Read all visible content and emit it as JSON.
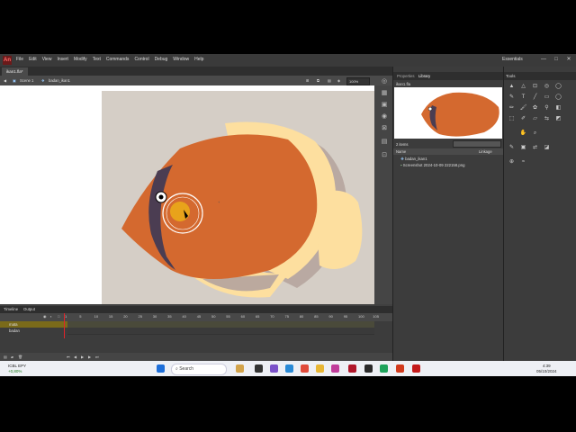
{
  "app": {
    "logo": "An",
    "workspace": "Essentials",
    "window_buttons": [
      "—",
      "□",
      "✕"
    ]
  },
  "menu": [
    "File",
    "Edit",
    "View",
    "Insert",
    "Modify",
    "Text",
    "Commands",
    "Control",
    "Debug",
    "Window",
    "Help"
  ],
  "document": {
    "tab_label": "ikan1.fla*",
    "scene": "Scene 1",
    "symbol": "badan_ikan1",
    "zoom": "100%"
  },
  "timeline": {
    "tabs": [
      "Timeline",
      "Output"
    ],
    "layers": [
      {
        "name": "mata",
        "selected": true
      },
      {
        "name": "badan",
        "selected": false
      }
    ],
    "ticks": [
      "1",
      "5",
      "10",
      "15",
      "20",
      "25",
      "30",
      "35",
      "40",
      "45",
      "50",
      "55",
      "60",
      "65",
      "70",
      "75",
      "80",
      "85",
      "90",
      "95",
      "100",
      "105"
    ]
  },
  "properties": {
    "tabs": [
      "Properties",
      "Library"
    ],
    "library_file": "ikan1.fla",
    "item_count": "2 items"
  },
  "library": {
    "header_name": "Name",
    "header_linkage": "Linkage",
    "items": [
      {
        "name": "badan_ikan1",
        "icon": "movie-clip-icon"
      },
      {
        "name": "Screenshot 2024-10-09 222158.png",
        "icon": "bitmap-icon"
      }
    ]
  },
  "tools": {
    "title": "Tools"
  },
  "taskbar": {
    "weather_temp": "ICBL EPY",
    "weather_change": "+0,80%",
    "search_placeholder": "Search",
    "time": "4:39",
    "date": "05/10/2024"
  },
  "colors": {
    "fish_body": "#D4692F",
    "fish_stripe": "#4B3D52",
    "fin": "#FDDF9F",
    "eye": "#E8A31B",
    "stage_bg": "#D5CEC6"
  }
}
